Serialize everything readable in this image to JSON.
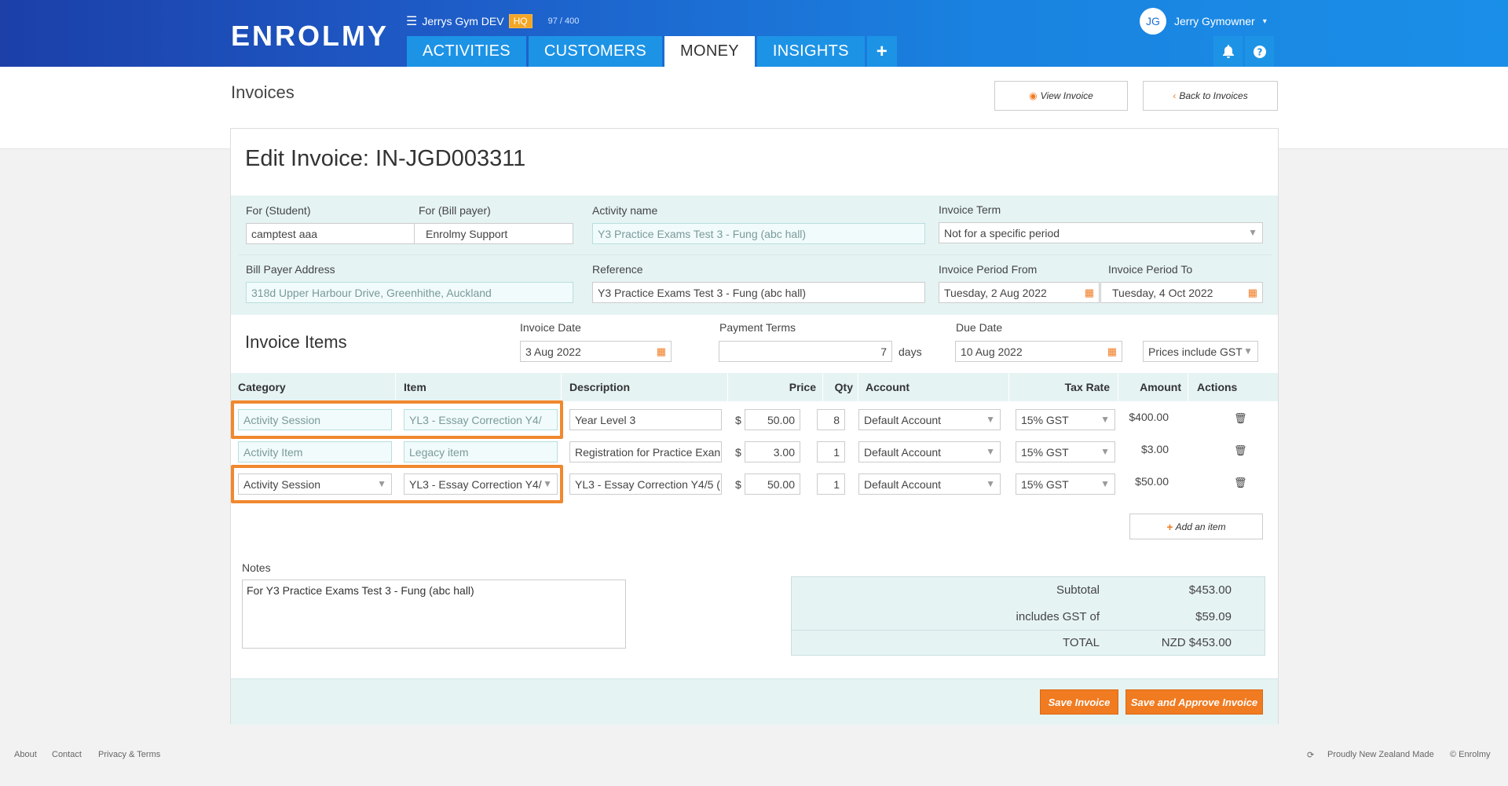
{
  "header": {
    "logo": "ENROLMY",
    "account_name": "Jerrys Gym DEV",
    "hq_badge": "HQ",
    "count": "97 / 400",
    "user_initials": "JG",
    "user_name": "Jerry Gymowner",
    "tabs": [
      "ACTIVITIES",
      "CUSTOMERS",
      "MONEY",
      "INSIGHTS"
    ],
    "active_tab": "MONEY"
  },
  "page": {
    "title": "Invoices",
    "view_invoice": "View Invoice",
    "back_to_invoices": "Back to Invoices"
  },
  "invoice": {
    "edit_title": "Edit Invoice: IN-JGD003311",
    "for_student_label": "For (Student)",
    "for_student": "camptest aaa",
    "for_bill_payer_label": "For (Bill payer)",
    "for_bill_payer": "Enrolmy Support",
    "activity_name_label": "Activity name",
    "activity_name": "Y3 Practice Exams Test 3 - Fung (abc hall)",
    "invoice_term_label": "Invoice Term",
    "invoice_term": "Not for a specific period",
    "bill_payer_address_label": "Bill Payer Address",
    "bill_payer_address": "318d Upper Harbour Drive, Greenhithe, Auckland",
    "reference_label": "Reference",
    "reference": "Y3 Practice Exams Test 3 - Fung (abc hall)",
    "period_from_label": "Invoice Period From",
    "period_from": "Tuesday, 2 Aug 2022",
    "period_to_label": "Invoice Period To",
    "period_to": "Tuesday, 4 Oct 2022"
  },
  "items_section": {
    "title": "Invoice Items",
    "invoice_date_label": "Invoice Date",
    "invoice_date": "3 Aug 2022",
    "payment_terms_label": "Payment Terms",
    "payment_terms": "7",
    "days": "days",
    "due_date_label": "Due Date",
    "due_date": "10 Aug 2022",
    "gst_mode": "Prices include GST"
  },
  "columns": [
    "Category",
    "Item",
    "Description",
    "Price",
    "Qty",
    "Account",
    "Tax Rate",
    "Amount",
    "Actions"
  ],
  "rows": [
    {
      "category": "Activity Session",
      "item": "YL3 - Essay Correction Y4/",
      "description": "Year Level 3",
      "currency": "$",
      "price": "50.00",
      "qty": "8",
      "account": "Default Account",
      "tax": "15% GST",
      "amount": "$400.00"
    },
    {
      "category": "Activity Item",
      "item": "Legacy item",
      "description": "Registration for Practice Exan",
      "currency": "$",
      "price": "3.00",
      "qty": "1",
      "account": "Default Account",
      "tax": "15% GST",
      "amount": "$3.00"
    },
    {
      "category": "Activity Session",
      "item": "YL3 - Essay Correction Y4/",
      "description": "YL3 - Essay Correction Y4/5 (",
      "currency": "$",
      "price": "50.00",
      "qty": "1",
      "account": "Default Account",
      "tax": "15% GST",
      "amount": "$50.00"
    }
  ],
  "add_item": "Add an item",
  "notes_label": "Notes",
  "notes": "For Y3 Practice Exams Test 3 - Fung (abc hall)",
  "totals": {
    "subtotal_label": "Subtotal",
    "subtotal": "$453.00",
    "gst_label": "includes GST of",
    "gst": "$59.09",
    "total_label": "TOTAL",
    "total": "NZD $453.00"
  },
  "actions": {
    "save": "Save Invoice",
    "save_approve": "Save and Approve Invoice"
  },
  "footer": {
    "about": "About",
    "contact": "Contact",
    "privacy": "Privacy & Terms",
    "made": "Proudly New Zealand Made",
    "copyright": "© Enrolmy"
  },
  "colors": {
    "brand_blue": "#1a82e0",
    "accent_orange": "#f07b21",
    "panel_teal": "#e6f3f3",
    "hq_yellow": "#f5a623"
  }
}
